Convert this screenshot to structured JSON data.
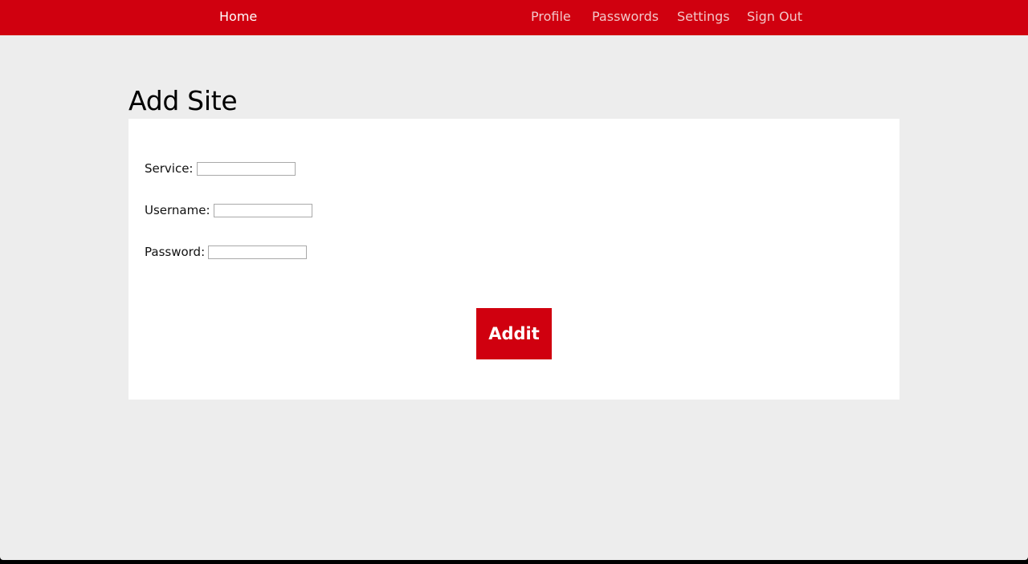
{
  "nav": {
    "home": "Home",
    "profile": "Profile",
    "passwords": "Passwords",
    "settings": "Settings",
    "sign_out": "Sign Out"
  },
  "page": {
    "title": "Add Site"
  },
  "form": {
    "service_label": "Service:",
    "service_value": "",
    "username_label": "Username:",
    "username_value": "",
    "password_label": "Password:",
    "password_value": "",
    "submit_label": "Addit"
  },
  "colors": {
    "brand": "#d0000f",
    "background": "#ededed",
    "card": "#ffffff"
  }
}
